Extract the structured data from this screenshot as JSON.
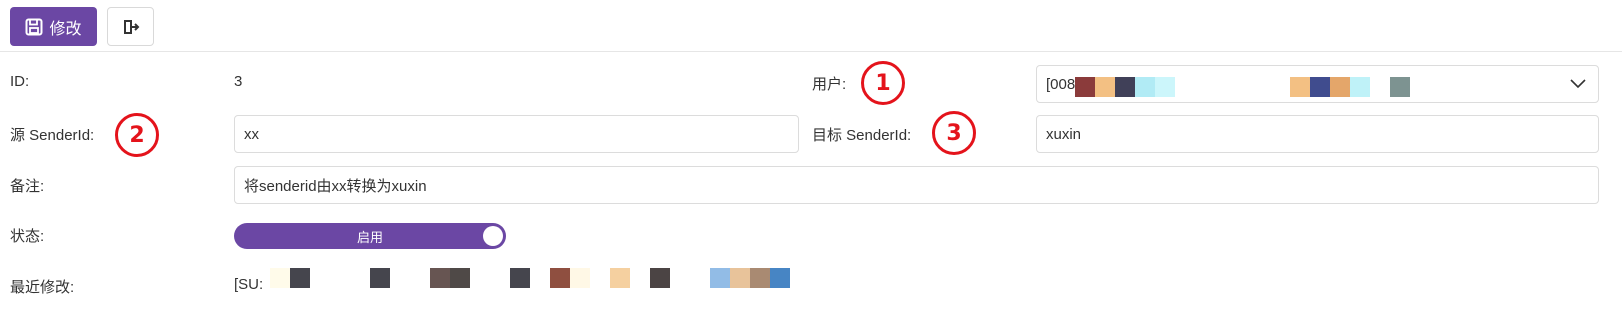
{
  "toolbar": {
    "save_label": "修改",
    "save_icon": "floppy-disk-icon",
    "exit_icon": "sign-out-icon",
    "accent": "#6b47a4"
  },
  "form": {
    "id_label": "ID:",
    "id_value": "3",
    "user_label": "用户:",
    "user_value_prefix": "[008",
    "source_label": "源 SenderId:",
    "source_value": "xx",
    "target_label": "目标 SenderId:",
    "target_value": "xuxin",
    "note_label": "备注:",
    "note_value": "将senderid由xx转换为xuxin",
    "status_label": "状态:",
    "status_value": "启用",
    "modified_label": "最近修改:",
    "modified_value_prefix": "[SU:"
  },
  "annotations": {
    "badge1": "1",
    "badge2": "2",
    "badge3": "3",
    "color": "#e4131b"
  }
}
